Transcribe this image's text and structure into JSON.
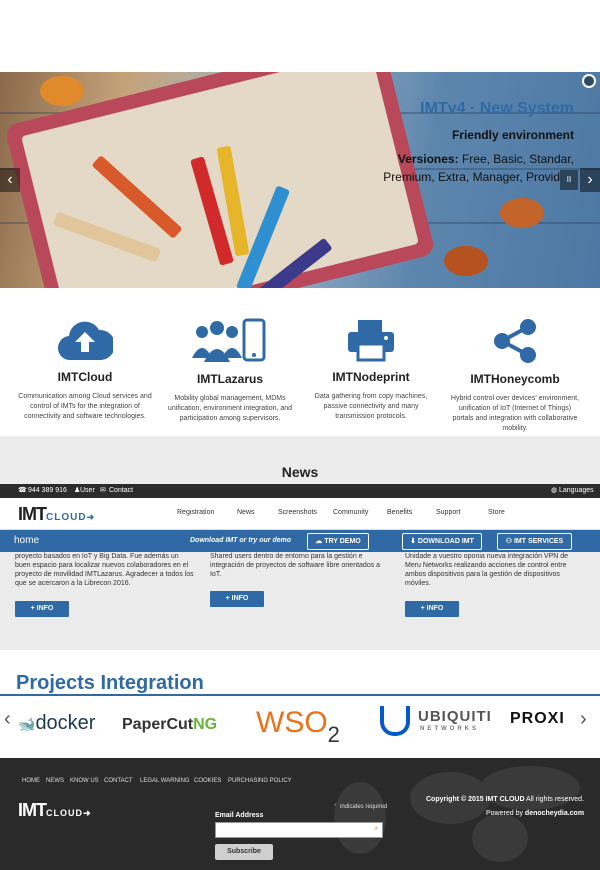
{
  "hero": {
    "title": "IMTv4 · New System",
    "subtitle": "Friendly environment",
    "versions_label": "Versiones:",
    "versions_line1": " Free, Basic, Standar,",
    "versions_line2": "Premium, Extra, Manager, Provid",
    "prev": "‹",
    "next": "›",
    "pause": "II"
  },
  "features": [
    {
      "title": "IMTCloud",
      "icon": "cloud-upload-icon",
      "desc": "Communication among Cloud services and control of IMTs for the integration of connectivity and software technologies."
    },
    {
      "title": "IMTLazarus",
      "icon": "users-phone-icon",
      "desc": "Mobility global management, MDMs unification, environment integration, and participation among supervisors."
    },
    {
      "title": "IMTNodeprint",
      "icon": "printer-icon",
      "desc": "Data gathering from copy machines, passive connectivity and many transmission protocols."
    },
    {
      "title": "IMTHoneycomb",
      "icon": "share-icon",
      "desc": "Hybrid control over devices' environment, unification of IoT (Internet of Things) portals and integration with collaborative mobility."
    }
  ],
  "news": {
    "heading": "News",
    "col1": "proyecto basados en IoT y Big Data. Fue además un buen espacio para localizar nuevos colaboradores en el proyecto de movilidad IMTLazarus. Agradecer a todos los que se acercaron a la Librecon 2016.",
    "col2": "Shared users dentro de entorno para la gestión e integración de proyectos de software libre orientados a IoT.",
    "col3": "Unidade a vuestro oponia nueva integración VPN de Meru Networks realizando acciones de control entre ambos dispositivos para la gestión de dispositivos móviles.",
    "info_label": "+ INFO"
  },
  "topbar": {
    "phone": "944 389 916",
    "user": "User",
    "contact": "Contact",
    "languages": "Languages"
  },
  "nav": {
    "logo_imt": "IMT",
    "logo_cloud": "CLOUD",
    "items": [
      "Registration",
      "News",
      "Screenshots",
      "Community",
      "Benefits",
      "Support",
      "Store"
    ]
  },
  "bluebar": {
    "home": "home",
    "tagline": "Download IMT or try our demo",
    "try_demo": "TRY DEMO",
    "download": "DOWNLOAD IMT",
    "services": "IMT SERVICES"
  },
  "projects": {
    "heading": "Projects Integration",
    "logos": [
      "docker",
      "PaperCut",
      "NG",
      "WSO",
      "2",
      "UBIQUITI",
      "NETWORKS",
      "PROXI"
    ],
    "prev": "‹",
    "next": "›"
  },
  "footer": {
    "links": [
      "HOME",
      "NEWS",
      "KNOW US",
      "CONTACT",
      "LEGAL WARNING",
      "COOKIES",
      "PURCHASING POLICY"
    ],
    "logo_imt": "IMT",
    "logo_cloud": "CLOUD",
    "required_note": "indicates required",
    "email_label": "Email Address",
    "subscribe": "Subscribe",
    "copyright_prefix": "Copyright © 2015 IMT CLOUD",
    "copyright_suffix": " All rights reserved.",
    "powered_prefix": "Powered by ",
    "powered_by": "denocheydia.com"
  },
  "colors": {
    "accent": "#2f6aa6",
    "dark": "#2a2a2a"
  }
}
